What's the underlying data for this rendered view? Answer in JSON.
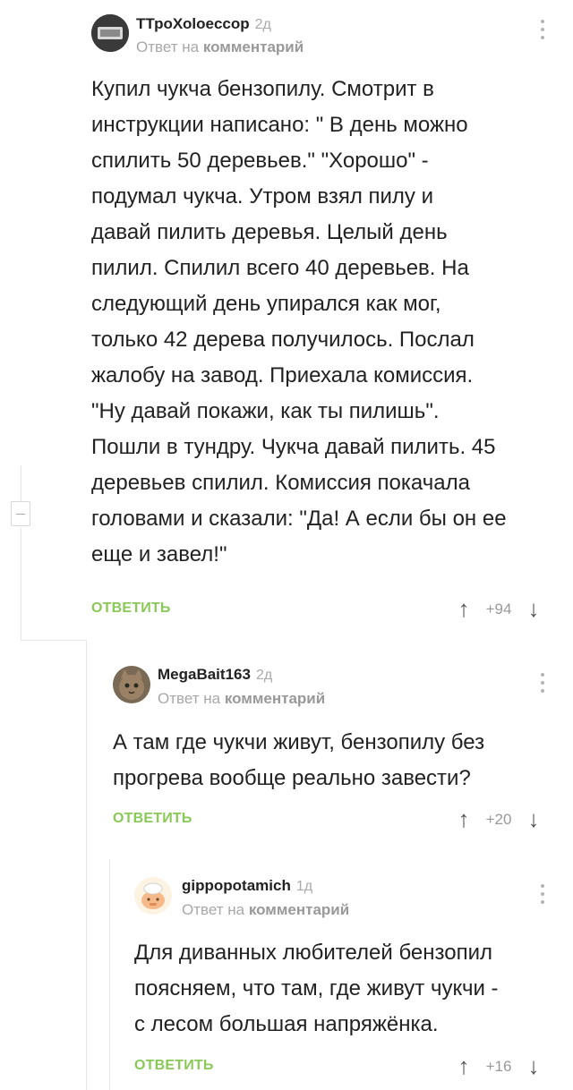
{
  "comments": [
    {
      "author": "ТТроХоloeccop",
      "age": "2д",
      "reply_prefix": "Ответ на",
      "reply_target": "комментарий",
      "text_lines": [
        "Купил чукча бензопилу. Смотрит в",
        "инструкции написано: \" В день можно",
        "спилить 50 деревьев.\" \"Хорошо\" -",
        "подумал чукча. Утром взял пилу и",
        "давай пилить деревья. Целый день",
        "пилил. Спилил всего 40 деревьев. На",
        "следующий день упирался как мог,",
        "только 42 дерева получилось. Послал",
        "жалобу на завод. Приехала комиссия.",
        "\"Ну давай покажи, как ты пилишь\".",
        "Пошли в тундру. Чукча давай пилить. 45",
        "деревьев спилил. Комиссия покачала",
        "головами и сказали: \"Да! А если бы он ее",
        "еще и завел!\""
      ],
      "reply_label": "ОТВЕТИТЬ",
      "rating": "+94"
    },
    {
      "author": "MegaBait163",
      "age": "2д",
      "reply_prefix": "Ответ на",
      "reply_target": "комментарий",
      "text_lines": [
        "А там где чукчи живут, бензопилу без",
        "прогрева вообще реально завести?"
      ],
      "reply_label": "ОТВЕТИТЬ",
      "rating": "+20"
    },
    {
      "author": "gippopotamich",
      "age": "1д",
      "reply_prefix": "Ответ на",
      "reply_target": "комментарий",
      "text_lines": [
        "Для диванных любителей бензопил",
        "поясняем, что там, где живут чукчи -",
        "с лесом большая напряжёнка."
      ],
      "reply_label": "ОТВЕТИТЬ",
      "rating": "+16"
    }
  ],
  "icons": {
    "upvote": "arrow-up-icon",
    "downvote": "arrow-down-icon",
    "menu": "more-vertical-icon",
    "collapse": "collapse-icon"
  },
  "colors": {
    "reply_button": "#8ac858",
    "muted_text": "#a8a8a8",
    "thread_line": "#e6e6e6"
  }
}
